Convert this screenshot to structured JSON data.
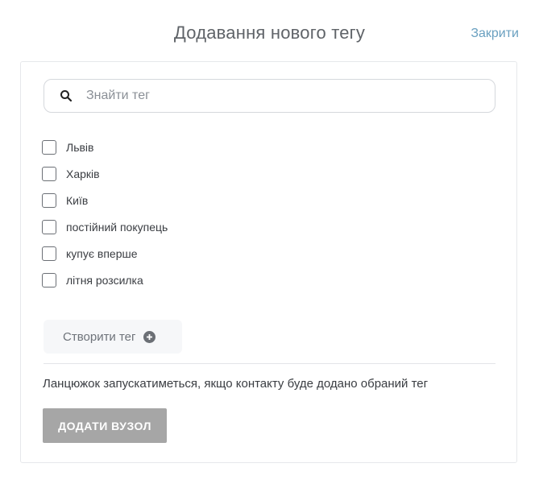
{
  "header": {
    "title": "Додавання нового тегу",
    "close_label": "Закрити"
  },
  "search": {
    "placeholder": "Знайти тег",
    "value": "",
    "icon": "search-icon"
  },
  "tags": [
    {
      "label": "Львів",
      "checked": false
    },
    {
      "label": "Харків",
      "checked": false
    },
    {
      "label": "Київ",
      "checked": false
    },
    {
      "label": "постійний покупець",
      "checked": false
    },
    {
      "label": "купує вперше",
      "checked": false
    },
    {
      "label": "літня розсилка",
      "checked": false
    }
  ],
  "create_tag": {
    "label": "Створити тег",
    "icon": "plus-circle-icon"
  },
  "hint": "Ланцюжок запускатиметься, якщо контакту буде додано обраний тег",
  "add_node_button": {
    "label": "ДОДАТИ ВУЗОЛ",
    "disabled": true
  },
  "colors": {
    "accent_link": "#6aa0c0",
    "button_disabled": "#a6a6a6"
  }
}
